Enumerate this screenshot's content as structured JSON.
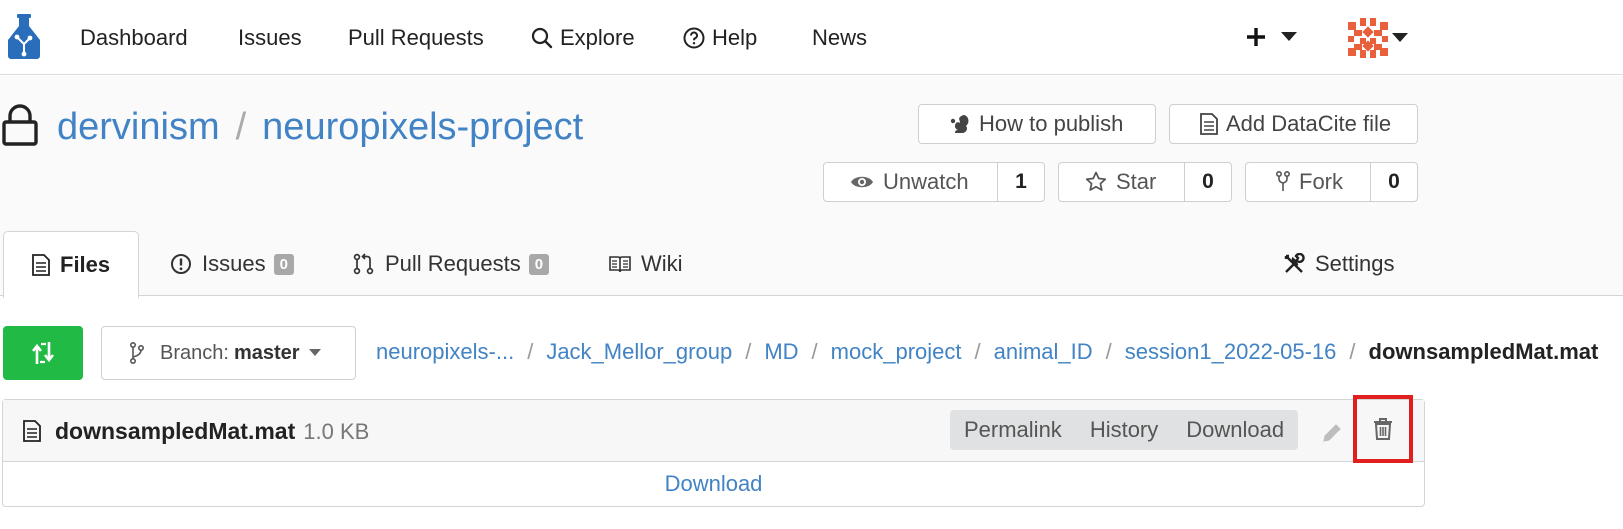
{
  "nav": {
    "items": [
      {
        "label": "Dashboard"
      },
      {
        "label": "Issues"
      },
      {
        "label": "Pull Requests"
      },
      {
        "label": "Explore",
        "icon": "search-icon"
      },
      {
        "label": "Help",
        "icon": "help-icon"
      },
      {
        "label": "News"
      }
    ]
  },
  "repo": {
    "owner": "dervinism",
    "separator": "/",
    "name": "neuropixels-project",
    "how_to_publish": "How to publish",
    "add_datacite": "Add DataCite file",
    "watch_label": "Unwatch",
    "watch_count": "1",
    "star_label": "Star",
    "star_count": "0",
    "fork_label": "Fork",
    "fork_count": "0"
  },
  "tabs": [
    {
      "label": "Files"
    },
    {
      "label": "Issues",
      "badge": "0"
    },
    {
      "label": "Pull Requests",
      "badge": "0"
    },
    {
      "label": "Wiki"
    },
    {
      "label": "Settings"
    }
  ],
  "branch": {
    "prefix": "Branch:",
    "name": "master"
  },
  "breadcrumb": {
    "separator": "/",
    "items": [
      "neuropixels-...",
      "Jack_Mellor_group",
      "MD",
      "mock_project",
      "animal_ID",
      "session1_2022-05-16"
    ],
    "current": "downsampledMat.mat"
  },
  "file": {
    "name": "downsampledMat.mat",
    "size": "1.0 KB",
    "permalink": "Permalink",
    "history": "History",
    "download": "Download",
    "body_link": "Download"
  },
  "colors": {
    "link": "#4183c4",
    "green": "#21ba45",
    "highlight": "#e01f1f",
    "logo": "#2a6ebb",
    "avatar": "#e8603c"
  }
}
